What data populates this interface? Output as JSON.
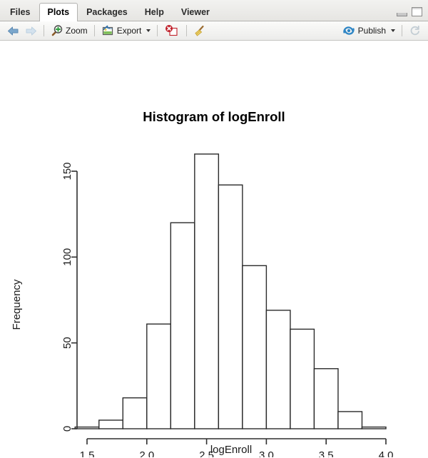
{
  "window": {
    "minimize_label": "minimize",
    "maximize_label": "maximize"
  },
  "tabs": [
    {
      "label": "Files",
      "active": false
    },
    {
      "label": "Plots",
      "active": true
    },
    {
      "label": "Packages",
      "active": false
    },
    {
      "label": "Help",
      "active": false
    },
    {
      "label": "Viewer",
      "active": false
    }
  ],
  "toolbar": {
    "back_icon": "back-arrow-icon",
    "forward_icon": "forward-arrow-icon",
    "zoom_label": "Zoom",
    "zoom_icon": "magnifier-plus-icon",
    "export_label": "Export",
    "export_icon": "export-image-icon",
    "remove_icon": "remove-plot-icon",
    "clear_icon": "clear-all-plots-broom-icon",
    "publish_label": "Publish",
    "publish_icon": "publish-icon",
    "refresh_icon": "refresh-icon"
  },
  "colors": {
    "accent_blue": "#2f86c5",
    "remove_red": "#c0202a",
    "tab_active_bg": "#ffffff",
    "toolbar_bg": "#ececea",
    "plot_ink": "#2b2b2b",
    "plot_bg": "#ffffff"
  },
  "chart_data": {
    "type": "bar",
    "title": "Histogram of logEnroll",
    "xlabel": "logEnroll",
    "ylabel": "Frequency",
    "subtitle": "",
    "grid": false,
    "legend": false,
    "bin_width": 0.2,
    "bin_edges": [
      1.4,
      1.6,
      1.8,
      2.0,
      2.2,
      2.4,
      2.6,
      2.8,
      3.0,
      3.2,
      3.4,
      3.6,
      3.8,
      4.0
    ],
    "categories": [
      "1.4-1.6",
      "1.6-1.8",
      "1.8-2.0",
      "2.0-2.2",
      "2.2-2.4",
      "2.4-2.6",
      "2.6-2.8",
      "2.8-3.0",
      "3.0-3.2",
      "3.2-3.4",
      "3.4-3.6",
      "3.6-3.8",
      "3.8-4.0"
    ],
    "values": [
      1,
      5,
      18,
      61,
      120,
      160,
      142,
      95,
      69,
      58,
      35,
      10,
      1
    ],
    "xlim": [
      1.4,
      4.0
    ],
    "ylim": [
      0,
      160
    ],
    "xticks": [
      1.5,
      2.0,
      2.5,
      3.0,
      3.5,
      4.0
    ],
    "xtick_labels": [
      "1.5",
      "2.0",
      "2.5",
      "3.0",
      "3.5",
      "4.0"
    ],
    "yticks": [
      0,
      50,
      100,
      150
    ],
    "ytick_labels": [
      "0",
      "50",
      "100",
      "150"
    ],
    "y_axis_range": [
      0,
      150
    ]
  }
}
